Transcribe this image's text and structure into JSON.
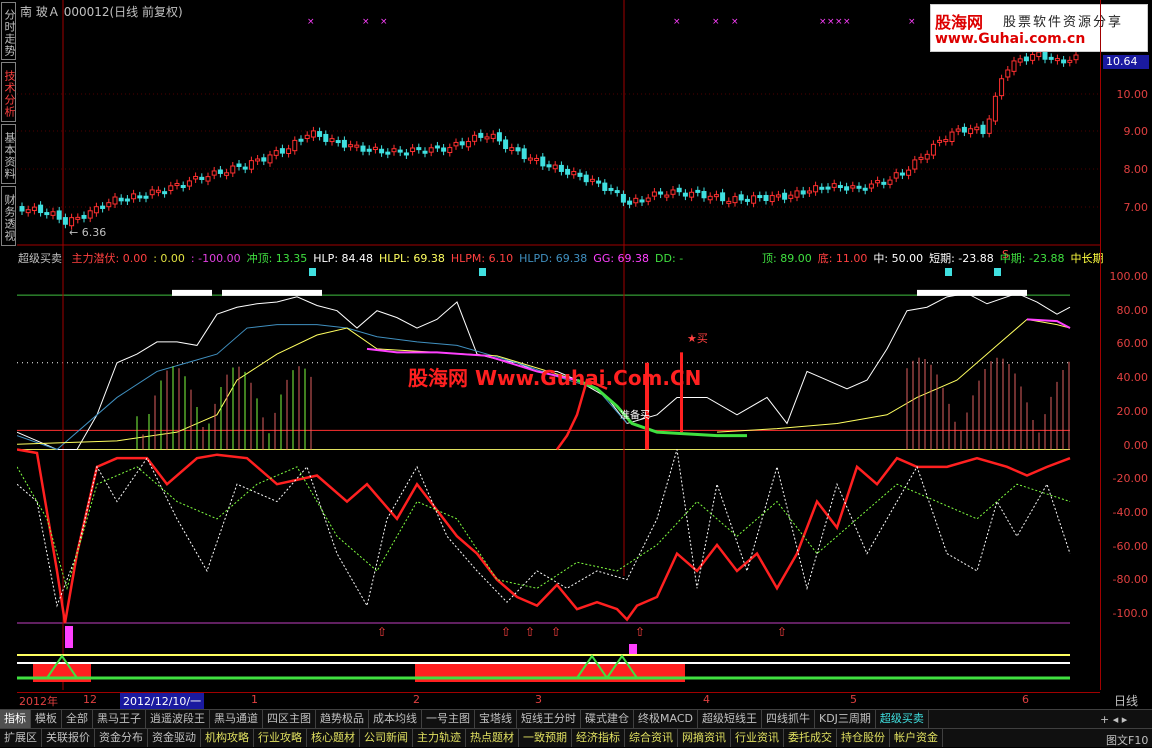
{
  "header": {
    "market": "南",
    "stock_name": "玻Ａ",
    "stock_code": "000012",
    "mode": "(日线 前复权)"
  },
  "left_tabs": [
    {
      "label": "分时走势",
      "active": false
    },
    {
      "label": "技术分析",
      "active": true
    },
    {
      "label": "基本资料",
      "active": false
    },
    {
      "label": "财务透视",
      "active": false
    }
  ],
  "logo": {
    "brand": "股海网",
    "tagline": "股票软件资源分享",
    "url": "www.Guhai.com.cn"
  },
  "price_axis": {
    "labels": [
      "10.64",
      "10.00",
      "9.00",
      "8.00",
      "7.00"
    ],
    "current_price": "10.64",
    "low_marker": "6.36"
  },
  "indicator": {
    "name": "超级买卖",
    "items": [
      {
        "label": "主力潜伏: 0.00",
        "color": "#ff4040"
      },
      {
        "label": ": 0.00",
        "color": "#e0e040"
      },
      {
        "label": ": -100.00",
        "color": "#e040e0"
      },
      {
        "label": "冲顶: 13.35",
        "color": "#40e040"
      },
      {
        "label": "HLP: 84.48",
        "color": "#ffffff"
      },
      {
        "label": "HLPL: 69.38",
        "color": "#ffff60"
      },
      {
        "label": "HLPM: 6.10",
        "color": "#ff4040"
      },
      {
        "label": "HLPD: 69.38",
        "color": "#4090c0"
      },
      {
        "label": "GG: 69.38",
        "color": "#ff40ff"
      },
      {
        "label": "DD: -",
        "color": "#40e040"
      }
    ],
    "items_right": [
      {
        "label": "顶: 89.00",
        "color": "#40e040"
      },
      {
        "label": "底: 11.00",
        "color": "#ff4040"
      },
      {
        "label": "中: 50.00",
        "color": "#ffffff"
      },
      {
        "label": "短期: -23.88",
        "color": "#ffffff"
      },
      {
        "label": "中期: -23.88",
        "color": "#40e040"
      },
      {
        "label": "中长期",
        "color": "#ffff40"
      }
    ],
    "axis_labels": [
      "100.00",
      "80.00",
      "60.00",
      "40.00",
      "20.00",
      "0.00",
      "-20.00",
      "-40.00",
      "-60.00",
      "-80.00",
      "-100.0"
    ],
    "annotations": {
      "buy": "买",
      "ready": "准备买",
      "s_marker": "S"
    }
  },
  "watermark": "股海网 Www.Guhai.Com.CN",
  "date_bar": {
    "labels": [
      "2012年",
      "12",
      "2012/12/10/一",
      "1",
      "2",
      "3",
      "4",
      "5",
      "6"
    ],
    "period": "日线"
  },
  "tabs_row1": [
    "指标",
    "模板",
    "全部",
    "黑马王子",
    "逍遥波段王",
    "黑马通道",
    "四区主图",
    "趋势极品",
    "成本均线",
    "一号主图",
    "宝塔线",
    "短线王分时",
    "碟式建仓",
    "终极MACD",
    "超级短线王",
    "四线抓牛",
    "KDJ三周期",
    "超级买卖"
  ],
  "tabs_row2": [
    "扩展区",
    "关联报价",
    "资金分布",
    "资金驱动",
    "机构攻略",
    "行业攻略",
    "核心题材",
    "公司新闻",
    "主力轨迹",
    "热点题材",
    "一致预期",
    "经济指标",
    "综合资讯",
    "网摘资讯",
    "行业资讯",
    "委托成交",
    "持仓股份",
    "帐户资金"
  ],
  "row_buttons": {
    "plus": "+",
    "settings": "⚙",
    "fkey": "图文F10"
  },
  "colors": {
    "up": "#ff3030",
    "down": "#40e0e0",
    "axis": "#a00000"
  }
}
